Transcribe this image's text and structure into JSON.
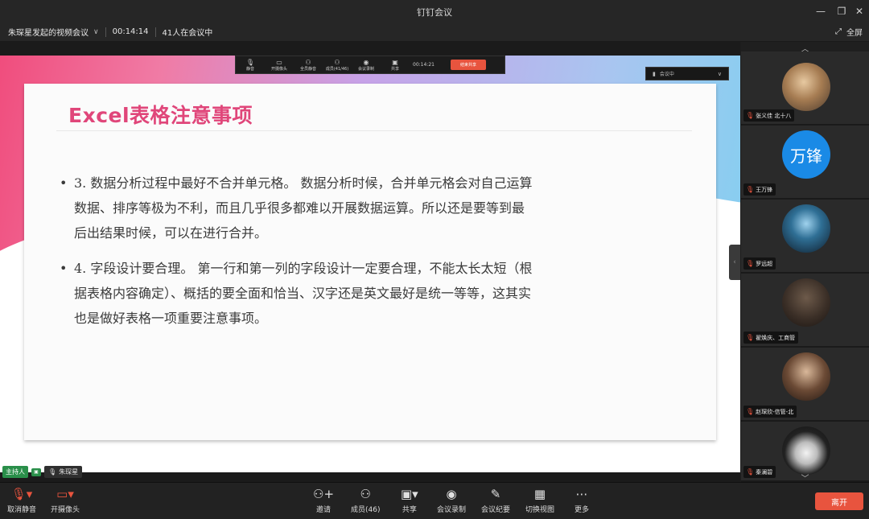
{
  "window": {
    "title": "钉钉会议"
  },
  "info": {
    "meeting_name": "朱琛星发起的视频会议",
    "elapsed": "00:14:14",
    "attendees": "41人在会议中",
    "fullscreen_label": "全屏"
  },
  "sharebar": {
    "items": [
      {
        "label": "静音",
        "icon": "mic-icon",
        "glyph": "🎙"
      },
      {
        "label": "开摄像头",
        "icon": "camera-icon",
        "glyph": "▭"
      },
      {
        "label": "全员静音",
        "icon": "mute-all-icon",
        "glyph": "⚇"
      },
      {
        "label": "成员(41/46)",
        "icon": "members-icon",
        "glyph": "⚇"
      },
      {
        "label": "会议录制",
        "icon": "record-icon",
        "glyph": "◉"
      },
      {
        "label": "共享",
        "icon": "share-icon",
        "glyph": "▣"
      }
    ],
    "time": "00:14:21",
    "stop_label": "结束共享"
  },
  "share_badge": "会议中",
  "slide": {
    "heading": "Excel表格注意事项",
    "bullets": [
      {
        "dot": "•",
        "text": "3. 数据分析过程中最好不合并单元格。 数据分析时候，合并单元格会对自己运算数据、排序等极为不利，而且几乎很多都难以开展数据运算。所以还是要等到最后出结果时候，可以在进行合并。"
      },
      {
        "dot": "•",
        "text": "4. 字段设计要合理。 第一行和第一列的字段设计一定要合理，不能太长太短（根据表格内容确定）、概括的要全面和恰当、汉字还是英文最好是统一等等，这其实也是做好表格一项重要注意事项。"
      }
    ]
  },
  "host": {
    "tag": "主持人",
    "name": "朱琛星"
  },
  "participants": [
    {
      "name": "张义佳 北十八",
      "avatar": "photo"
    },
    {
      "name": "王万锋",
      "avatar": "text",
      "initials": "万锋"
    },
    {
      "name": "罗远超",
      "avatar": "photo"
    },
    {
      "name": "翟焕庆、工商管",
      "avatar": "photo"
    },
    {
      "name": "赵琛欣-信管-北",
      "avatar": "photo"
    },
    {
      "name": "秦澜碧",
      "avatar": "photo"
    }
  ],
  "toolbar": {
    "mute_label": "取消静音",
    "camera_label": "开摄像头",
    "invite_label": "邀请",
    "members_label": "成员(46)",
    "share_label": "共享",
    "record_label": "会议录制",
    "minutes_label": "会议纪要",
    "switch_view_label": "切换视图",
    "more_label": "更多",
    "leave_label": "离开"
  },
  "colors": {
    "accent_red": "#e8543e",
    "heading_pink": "#e0467a",
    "avatar_blue": "#1a8ae6",
    "host_green": "#2a8f4a"
  }
}
